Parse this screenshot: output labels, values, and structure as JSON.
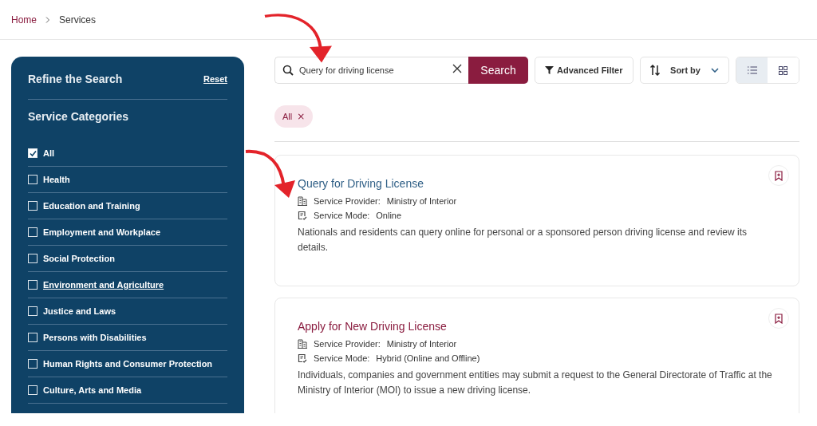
{
  "breadcrumb": [
    {
      "label": "Home",
      "current": false
    },
    {
      "label": "Services",
      "current": true
    }
  ],
  "sidebar": {
    "title": "Refine the Search",
    "reset": "Reset",
    "section": "Service Categories",
    "categories": [
      {
        "label": "All",
        "checked": true,
        "hovered": false
      },
      {
        "label": "Health",
        "checked": false,
        "hovered": false
      },
      {
        "label": "Education and Training",
        "checked": false,
        "hovered": false
      },
      {
        "label": "Employment and Workplace",
        "checked": false,
        "hovered": false
      },
      {
        "label": "Social Protection",
        "checked": false,
        "hovered": false
      },
      {
        "label": "Environment and Agriculture",
        "checked": false,
        "hovered": true
      },
      {
        "label": "Justice and Laws",
        "checked": false,
        "hovered": false
      },
      {
        "label": "Persons with Disabilities",
        "checked": false,
        "hovered": false
      },
      {
        "label": "Human Rights and Consumer Protection",
        "checked": false,
        "hovered": false
      },
      {
        "label": "Culture, Arts and Media",
        "checked": false,
        "hovered": false
      }
    ]
  },
  "search": {
    "value": "Query for driving license",
    "button": "Search"
  },
  "advanced_filter": "Advanced Filter",
  "sort": {
    "label": "Sort by"
  },
  "views": [
    {
      "kind": "list",
      "selected": true
    },
    {
      "kind": "grid",
      "selected": false
    }
  ],
  "chips": [
    {
      "label": "All",
      "remove": "×"
    }
  ],
  "services": [
    {
      "title": "Query for Driving License",
      "color": "#2f5f86",
      "provider_label": "Service Provider:",
      "provider": "Ministry of Interior",
      "mode_label": "Service Mode:",
      "mode": "Online",
      "description": "Nationals and residents can query online for personal or a sponsored person driving license and review its details."
    },
    {
      "title": "Apply for New Driving License",
      "color": "#8a1c3f",
      "provider_label": "Service Provider:",
      "provider": "Ministry of Interior",
      "mode_label": "Service Mode:",
      "mode": "Hybrid (Online and Offline)",
      "description": "Individuals, companies and government entities may submit a request to the General Directorate of Traffic at the Ministry of Interior (MOI) to issue a new driving license."
    }
  ]
}
